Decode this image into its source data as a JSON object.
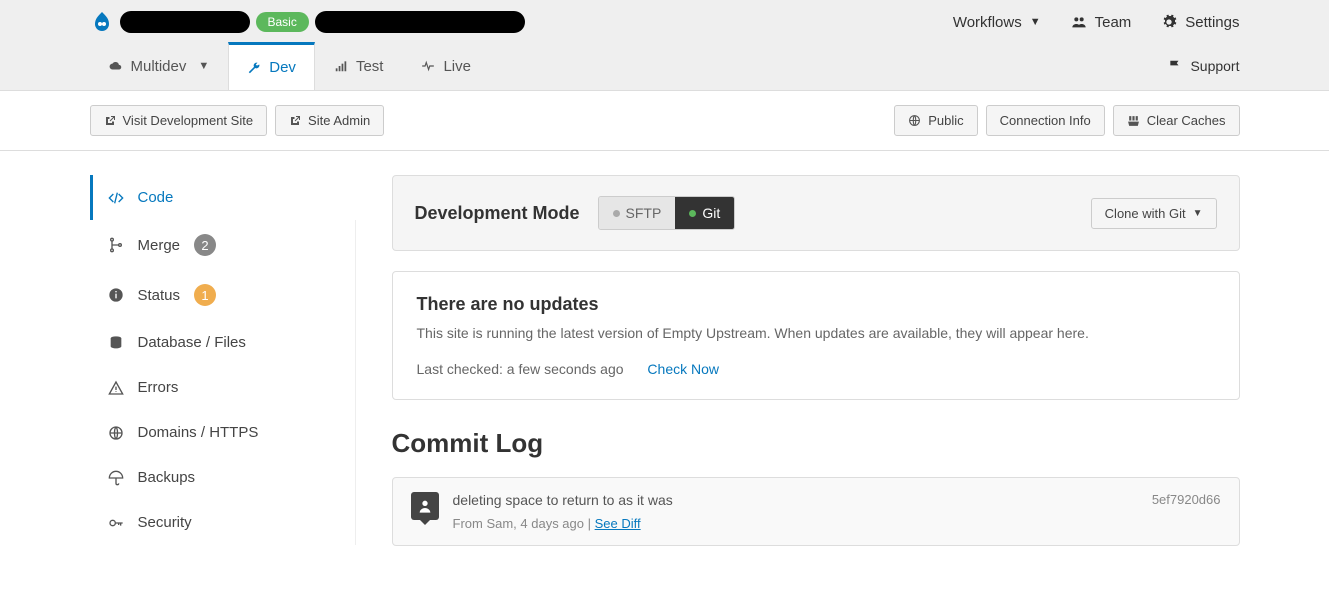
{
  "header": {
    "plan_badge": "Basic",
    "links": {
      "workflows": "Workflows",
      "team": "Team",
      "settings": "Settings"
    }
  },
  "env_tabs": {
    "multidev": "Multidev",
    "dev": "Dev",
    "test": "Test",
    "live": "Live",
    "support": "Support"
  },
  "actions": {
    "visit_site": "Visit Development Site",
    "site_admin": "Site Admin",
    "public": "Public",
    "connection_info": "Connection Info",
    "clear_caches": "Clear Caches"
  },
  "sidebar": {
    "code": "Code",
    "merge": "Merge",
    "merge_count": "2",
    "status": "Status",
    "status_count": "1",
    "database": "Database / Files",
    "errors": "Errors",
    "domains": "Domains / HTTPS",
    "backups": "Backups",
    "security": "Security"
  },
  "dev_mode": {
    "label": "Development Mode",
    "sftp": "SFTP",
    "git": "Git",
    "clone": "Clone with Git"
  },
  "updates": {
    "title": "There are no updates",
    "desc": "This site is running the latest version of Empty Upstream. When updates are available, they will appear here.",
    "last_checked": "Last checked: a few seconds ago",
    "check_now": "Check Now"
  },
  "commit_log": {
    "title": "Commit Log",
    "items": [
      {
        "message": "deleting space to return to as it was",
        "meta_prefix": "From Sam, 4 days ago",
        "see_diff": "See Diff",
        "hash": "5ef7920d66"
      }
    ]
  }
}
